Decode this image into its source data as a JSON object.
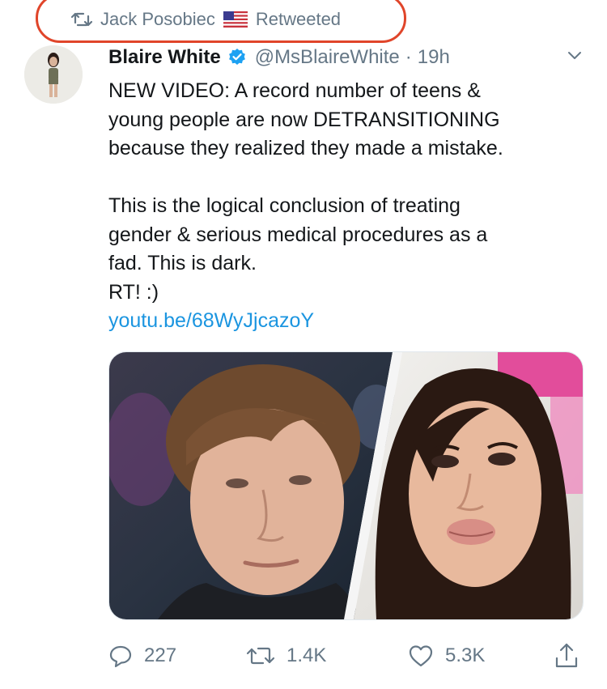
{
  "retweet": {
    "user": "Jack Posobiec",
    "label": "Retweeted",
    "icons": {
      "retweet": "retweet-icon",
      "flag": "us-flag-icon"
    }
  },
  "tweet": {
    "name": "Blaire White",
    "handle": "@MsBlaireWhite",
    "separator": "·",
    "time": "19h",
    "lines1": [
      "NEW VIDEO: A record number of teens &",
      "young people are now DETRANSITIONING",
      "because they realized they made a mistake."
    ],
    "lines2": [
      "This is the logical conclusion of treating",
      "gender & serious medical procedures as a",
      "fad. This is dark.",
      "RT! :)"
    ],
    "link": "youtu.be/68WyJjcazoY"
  },
  "actions": {
    "reply_count": "227",
    "retweet_count": "1.4K",
    "like_count": "5.3K"
  },
  "colors": {
    "text": "#14171a",
    "muted": "#657786",
    "link": "#1b95e0",
    "verified": "#1da1f2",
    "annotation": "#e0452a"
  }
}
